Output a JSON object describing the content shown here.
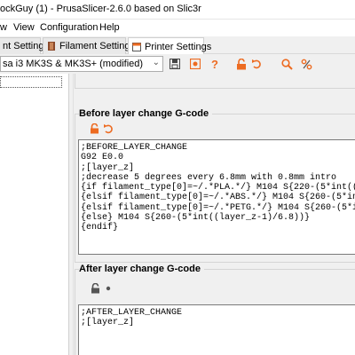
{
  "window": {
    "title": "ockGuy (1) - PrusaSlicer-2.6.0 based on Slic3r"
  },
  "menu": {
    "items": [
      "w",
      "View",
      "Configuration",
      "Help"
    ]
  },
  "tabs": [
    {
      "label": "nt Settings"
    },
    {
      "label": "Filament Settings"
    },
    {
      "label": "Printer Settings",
      "active": true
    }
  ],
  "preset": {
    "selected": "sa i3 MK3S & MK3S+ (modified)"
  },
  "icons": {
    "save": "save-icon",
    "copy": "copy-icon",
    "help": "question-icon",
    "lock": "lock-icon",
    "undo": "undo-arrow-icon",
    "search": "search-icon",
    "compare": "compare-icon"
  },
  "colors": {
    "accent": "#ed6b21",
    "bullet": "#555555"
  },
  "before_layer": {
    "title": "Before layer change G-code",
    "lines": [
      ";BEFORE_LAYER_CHANGE",
      "G92 E0.0",
      ";[layer_z]",
      ";decrease 5 degrees every 6.8mm with 0.8mm intro",
      "{if filament_type[0]=~/.*PLA.*/} M104 S{220-(5*int((layer_z",
      "{elsif filament_type[0]=~/.*ABS.*/} M104 S{260-(5*int((layer",
      "{elsif filament_type[0]=~/.*PETG.*/} M104 S{260-(5*int((laye",
      "{else} M104 S{260-(5*int((layer_z-1)/6.8))}",
      "{endif}"
    ]
  },
  "after_layer": {
    "title": "After layer change G-code",
    "lines": [
      ";AFTER_LAYER_CHANGE",
      ";[layer_z]"
    ]
  }
}
